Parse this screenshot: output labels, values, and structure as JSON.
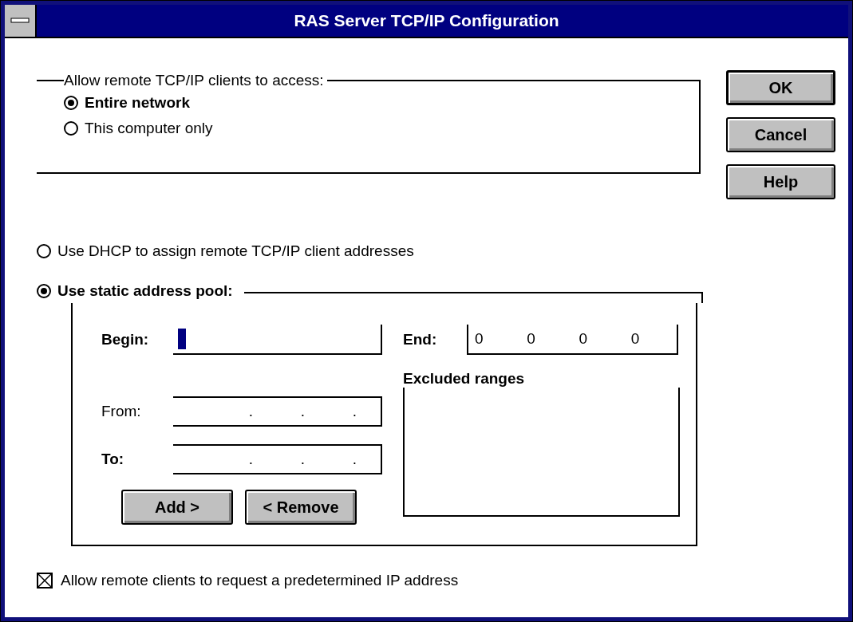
{
  "window": {
    "title": "RAS Server TCP/IP Configuration"
  },
  "access_group": {
    "label": "Allow remote TCP/IP clients to access:",
    "options": [
      {
        "label": "Entire network",
        "selected": true
      },
      {
        "label": "This computer only",
        "selected": false
      }
    ]
  },
  "address_options": [
    {
      "label": "Use DHCP to assign remote TCP/IP client addresses",
      "selected": false
    },
    {
      "label": "Use static address pool:",
      "selected": true
    }
  ],
  "static_pool": {
    "begin": {
      "label": "Begin:",
      "focused": true
    },
    "end": {
      "label": "End:",
      "octets": [
        "0",
        "0",
        "0",
        "0"
      ]
    },
    "excluded_label": "Excluded ranges",
    "from": {
      "label": "From:",
      "dots": [
        ".",
        ".",
        "."
      ]
    },
    "to": {
      "label": "To:",
      "dots": [
        ".",
        ".",
        "."
      ]
    },
    "buttons": [
      "Add >",
      "< Remove"
    ]
  },
  "allow_request": {
    "label": "Allow remote clients to request a predetermined IP address",
    "checked": true
  },
  "buttons": [
    {
      "label": "OK",
      "default": true
    },
    {
      "label": "Cancel",
      "default": false
    },
    {
      "label": "Help",
      "default": false
    }
  ]
}
